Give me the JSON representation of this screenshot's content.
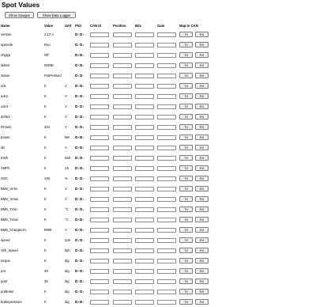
{
  "page": {
    "title": "Spot Values"
  },
  "toolbar": {
    "show_gauges": "Show Gauges",
    "show_data_logger": "Show Data Logger"
  },
  "headers": {
    "name": "Name",
    "value": "Value",
    "unit": "Unit",
    "plot": "Plot",
    "can_id": "CAN Id",
    "position": "Position",
    "bits": "Bits",
    "gain": "Gain",
    "map": "Map to CAN"
  },
  "plot_labels": [
    "l",
    "r"
  ],
  "buttons": {
    "tx": "TX",
    "rx": "RX"
  },
  "rows": [
    {
      "name": "version",
      "value": "2.17.A",
      "unit": ""
    },
    {
      "name": "opmode",
      "value": "Run",
      "unit": ""
    },
    {
      "name": "chgtyp",
      "value": "Off",
      "unit": ""
    },
    {
      "name": "lasterr",
      "value": "NONE",
      "unit": ""
    },
    {
      "name": "status",
      "value": "PotPressed",
      "unit": ""
    },
    {
      "name": "udc",
      "value": "0",
      "unit": "V"
    },
    {
      "name": "udc2",
      "value": "0",
      "unit": "V"
    },
    {
      "name": "udc3",
      "value": "0",
      "unit": "V"
    },
    {
      "name": "deltaV",
      "value": "0",
      "unit": "V"
    },
    {
      "name": "INVudc",
      "value": "334",
      "unit": "V"
    },
    {
      "name": "power",
      "value": "0",
      "unit": "kW"
    },
    {
      "name": "idc",
      "value": "0",
      "unit": "A"
    },
    {
      "name": "KWh",
      "value": "0",
      "unit": "kwh"
    },
    {
      "name": "AMPh",
      "value": "0",
      "unit": "Ah"
    },
    {
      "name": "SOC",
      "value": "100",
      "unit": "%"
    },
    {
      "name": "BMS_Vmin",
      "value": "0",
      "unit": "V"
    },
    {
      "name": "BMS_Vmax",
      "value": "0",
      "unit": "V"
    },
    {
      "name": "BMS_Tmin",
      "value": "0",
      "unit": "°C"
    },
    {
      "name": "BMS_Tmax",
      "value": "0",
      "unit": "°C"
    },
    {
      "name": "BMS_ChargeLim",
      "value": "9999",
      "unit": "A"
    },
    {
      "name": "speed",
      "value": "0",
      "unit": "rpm"
    },
    {
      "name": "Veh_Speed",
      "value": "0",
      "unit": "kph"
    },
    {
      "name": "torque",
      "value": "0",
      "unit": "dig"
    },
    {
      "name": "pot",
      "value": "39",
      "unit": "dig"
    },
    {
      "name": "pot2",
      "value": "35",
      "dig": "",
      "unit": "dig"
    },
    {
      "name": "potbrake",
      "value": "0",
      "unit": "dig"
    },
    {
      "name": "brakepressure",
      "value": "0",
      "unit": "dig"
    }
  ]
}
